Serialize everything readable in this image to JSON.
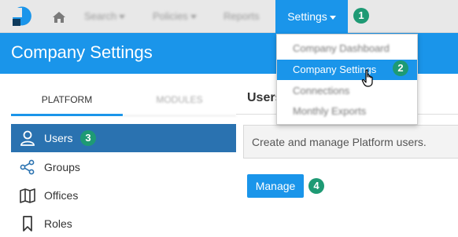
{
  "colors": {
    "brand_blue": "#1a95ea",
    "active_row": "#2a72b0",
    "callout_green": "#1e9a74",
    "nav_bg": "#e8e8e8"
  },
  "topnav": {
    "logo_icon": "brand-logo-icon",
    "home_icon": "home-icon",
    "search_label": "Search",
    "policies_label": "Policies",
    "reports_label": "Reports",
    "settings_label": "Settings"
  },
  "settings_menu": {
    "items": [
      {
        "label": "Company Dashboard"
      },
      {
        "label": "Company Settings"
      },
      {
        "label": "Connections"
      },
      {
        "label": "Monthly Exports"
      }
    ]
  },
  "banner": {
    "title": "Company Settings"
  },
  "tabs": {
    "platform": "PLATFORM",
    "modules": "MODULES"
  },
  "sidebar": {
    "items": [
      {
        "label": "Users",
        "icon": "user-icon"
      },
      {
        "label": "Groups",
        "icon": "share-icon"
      },
      {
        "label": "Offices",
        "icon": "map-icon"
      },
      {
        "label": "Roles",
        "icon": "bookmark-icon"
      }
    ]
  },
  "main": {
    "title": "Users",
    "description": "Create and manage Platform users.",
    "manage_label": "Manage"
  },
  "callouts": [
    "1",
    "2",
    "3",
    "4"
  ]
}
